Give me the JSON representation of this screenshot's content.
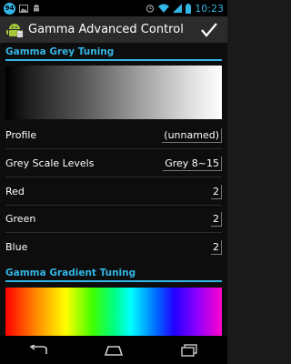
{
  "status_bar": {
    "notification_badge": "94",
    "time": "10:23",
    "icons": [
      "notification-badge-icon",
      "image-icon",
      "android-icon",
      "alarm-icon",
      "wifi-icon",
      "signal-icon",
      "battery-icon"
    ]
  },
  "action_bar": {
    "title": "Gamma Advanced Control",
    "app_icon": "android-app-icon",
    "confirm_icon": "checkmark-icon"
  },
  "sections": {
    "grey_tuning_header": "Gamma Grey Tuning",
    "gradient_tuning_header": "Gamma Gradient Tuning"
  },
  "settings": {
    "profile": {
      "label": "Profile",
      "value": "(unnamed)"
    },
    "grey_scale_levels": {
      "label": "Grey Scale Levels",
      "value": "Grey 8~15"
    },
    "red": {
      "label": "Red",
      "value": "2"
    },
    "green": {
      "label": "Green",
      "value": "2"
    },
    "blue": {
      "label": "Blue",
      "value": "2"
    }
  },
  "nav_bar": {
    "icons": [
      "back-icon",
      "home-icon",
      "recent-apps-icon"
    ]
  },
  "colors": {
    "accent": "#33b5e5",
    "background": "#0d0d0d",
    "action_bar": "#2b2b2b"
  }
}
